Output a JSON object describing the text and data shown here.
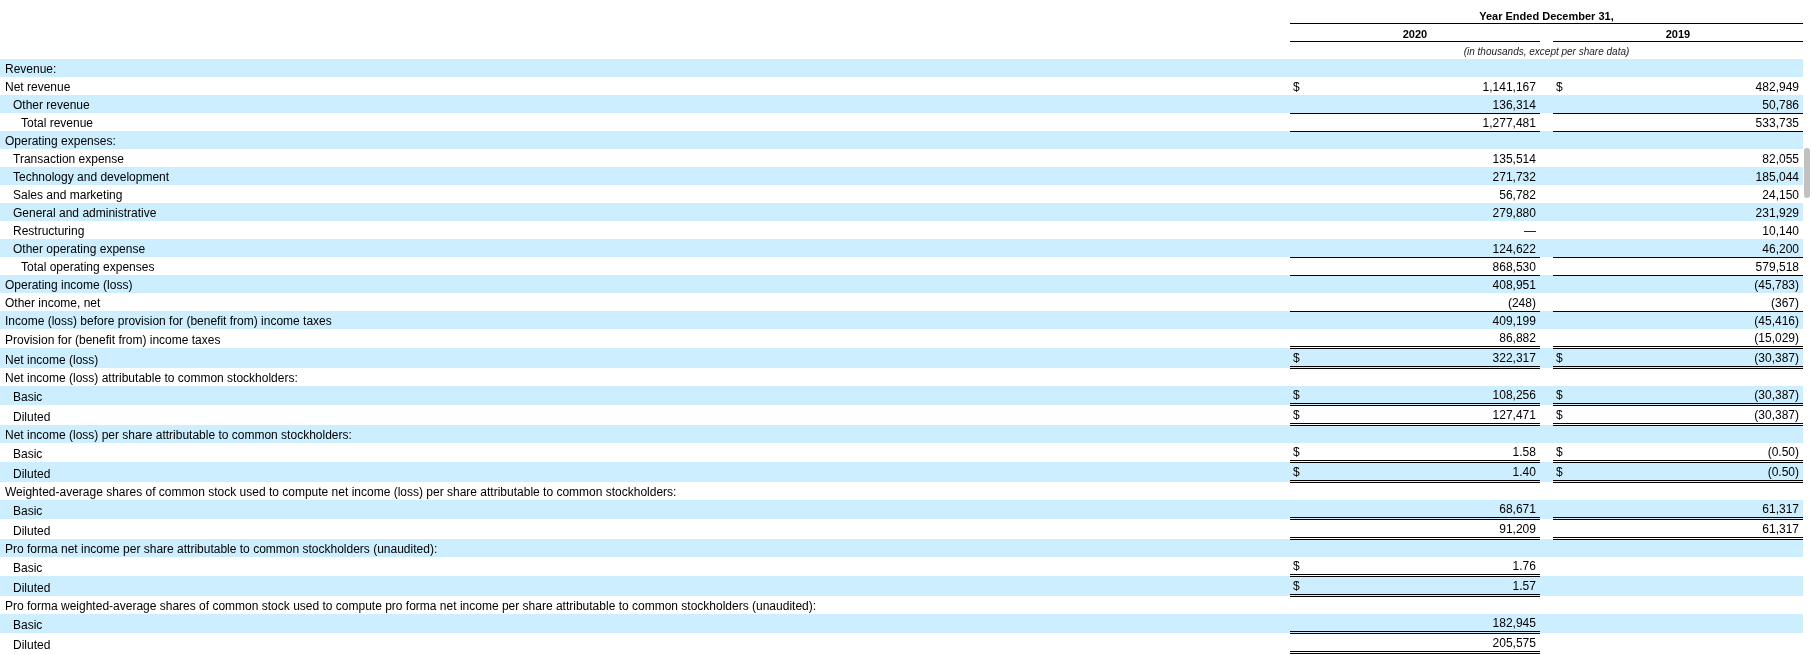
{
  "table": {
    "header": {
      "title": "Year Ended December 31,",
      "columns": [
        "2020",
        "2019"
      ],
      "note": "(in thousands, except per share data)"
    },
    "rows": [
      {
        "label": "Revenue:",
        "kind": "plain"
      },
      {
        "label": "Net revenue",
        "kind": "plain",
        "cells": [
          {
            "currency": "$",
            "value": "1,141,167",
            "kind": "plain"
          },
          {
            "currency": "$",
            "value": "482,949",
            "kind": "plain"
          }
        ]
      },
      {
        "label": "Other revenue",
        "kind": "item",
        "cells": [
          {
            "value": "136,314",
            "kind": "subtotal"
          },
          {
            "value": "50,786",
            "kind": "subtotal"
          }
        ]
      },
      {
        "label": "Total revenue",
        "kind": "total",
        "cells": [
          {
            "value": "1,277,481",
            "kind": "subtotal"
          },
          {
            "value": "533,735",
            "kind": "subtotal"
          }
        ]
      },
      {
        "label": "Operating expenses:",
        "kind": "plain"
      },
      {
        "label": "Transaction expense",
        "kind": "item",
        "cells": [
          {
            "value": "135,514",
            "kind": "plain"
          },
          {
            "value": "82,055",
            "kind": "plain"
          }
        ]
      },
      {
        "label": "Technology and development",
        "kind": "item",
        "cells": [
          {
            "value": "271,732",
            "kind": "plain"
          },
          {
            "value": "185,044",
            "kind": "plain"
          }
        ]
      },
      {
        "label": "Sales and marketing",
        "kind": "item",
        "cells": [
          {
            "value": "56,782",
            "kind": "plain"
          },
          {
            "value": "24,150",
            "kind": "plain"
          }
        ]
      },
      {
        "label": "General and administrative",
        "kind": "item",
        "cells": [
          {
            "value": "279,880",
            "kind": "plain"
          },
          {
            "value": "231,929",
            "kind": "plain"
          }
        ]
      },
      {
        "label": "Restructuring",
        "kind": "item",
        "cells": [
          {
            "value": "—",
            "kind": "plain"
          },
          {
            "value": "10,140",
            "kind": "plain"
          }
        ]
      },
      {
        "label": "Other operating expense",
        "kind": "item",
        "cells": [
          {
            "value": "124,622",
            "kind": "subtotal"
          },
          {
            "value": "46,200",
            "kind": "subtotal"
          }
        ]
      },
      {
        "label": "Total operating expenses",
        "kind": "total",
        "cells": [
          {
            "value": "868,530",
            "kind": "subtotal"
          },
          {
            "value": "579,518",
            "kind": "subtotal"
          }
        ]
      },
      {
        "label": "Operating income (loss)",
        "kind": "plain",
        "cells": [
          {
            "value": "408,951",
            "kind": "plain"
          },
          {
            "value": "(45,783)",
            "kind": "plain"
          }
        ]
      },
      {
        "label": "Other income, net",
        "kind": "plain",
        "cells": [
          {
            "value": "(248)",
            "kind": "subtotal"
          },
          {
            "value": "(367)",
            "kind": "subtotal"
          }
        ]
      },
      {
        "label": "Income (loss) before provision for (benefit from) income taxes",
        "kind": "plain",
        "cells": [
          {
            "value": "409,199",
            "kind": "plain"
          },
          {
            "value": "(45,416)",
            "kind": "plain"
          }
        ]
      },
      {
        "label": "Provision for (benefit from) income taxes",
        "kind": "plain",
        "cells": [
          {
            "value": "86,882",
            "kind": "total"
          },
          {
            "value": "(15,029)",
            "kind": "total"
          }
        ]
      },
      {
        "label": "Net income (loss)",
        "kind": "plain",
        "cells": [
          {
            "currency": "$",
            "value": "322,317",
            "kind": "total"
          },
          {
            "currency": "$",
            "value": "(30,387)",
            "kind": "total"
          }
        ]
      },
      {
        "label": "Net income (loss) attributable to common stockholders:",
        "kind": "plain"
      },
      {
        "label": "Basic",
        "kind": "item",
        "cells": [
          {
            "currency": "$",
            "value": "108,256",
            "kind": "total"
          },
          {
            "currency": "$",
            "value": "(30,387)",
            "kind": "total"
          }
        ]
      },
      {
        "label": "Diluted",
        "kind": "item",
        "cells": [
          {
            "currency": "$",
            "value": "127,471",
            "kind": "total"
          },
          {
            "currency": "$",
            "value": "(30,387)",
            "kind": "total"
          }
        ]
      },
      {
        "label": "Net income (loss) per share attributable to common stockholders:",
        "kind": "plain"
      },
      {
        "label": "Basic",
        "kind": "item",
        "cells": [
          {
            "currency": "$",
            "value": "1.58",
            "kind": "total"
          },
          {
            "currency": "$",
            "value": "(0.50)",
            "kind": "total"
          }
        ]
      },
      {
        "label": "Diluted",
        "kind": "item",
        "cells": [
          {
            "currency": "$",
            "value": "1.40",
            "kind": "total"
          },
          {
            "currency": "$",
            "value": "(0.50)",
            "kind": "total"
          }
        ]
      },
      {
        "label": "Weighted-average shares of common stock used to compute net income (loss) per share attributable to common stockholders:",
        "kind": "plain"
      },
      {
        "label": "Basic",
        "kind": "item",
        "cells": [
          {
            "value": "68,671",
            "kind": "total"
          },
          {
            "value": "61,317",
            "kind": "total"
          }
        ]
      },
      {
        "label": "Diluted",
        "kind": "item",
        "cells": [
          {
            "value": "91,209",
            "kind": "total"
          },
          {
            "value": "61,317",
            "kind": "total"
          }
        ]
      },
      {
        "label": "Pro forma net income per share attributable to common stockholders (unaudited):",
        "kind": "plain"
      },
      {
        "label": "Basic",
        "kind": "item",
        "cells": [
          {
            "currency": "$",
            "value": "1.76",
            "kind": "total"
          }
        ]
      },
      {
        "label": "Diluted",
        "kind": "item",
        "cells": [
          {
            "currency": "$",
            "value": "1.57",
            "kind": "total"
          }
        ]
      },
      {
        "label": "Pro forma weighted-average shares of common stock used to compute pro forma net income per share attributable to common stockholders (unaudited):",
        "kind": "plain"
      },
      {
        "label": "Basic",
        "kind": "item",
        "cells": [
          {
            "value": "182,945",
            "kind": "total"
          }
        ]
      },
      {
        "label": "Diluted",
        "kind": "item",
        "cells": [
          {
            "value": "205,575",
            "kind": "total"
          }
        ]
      }
    ]
  }
}
